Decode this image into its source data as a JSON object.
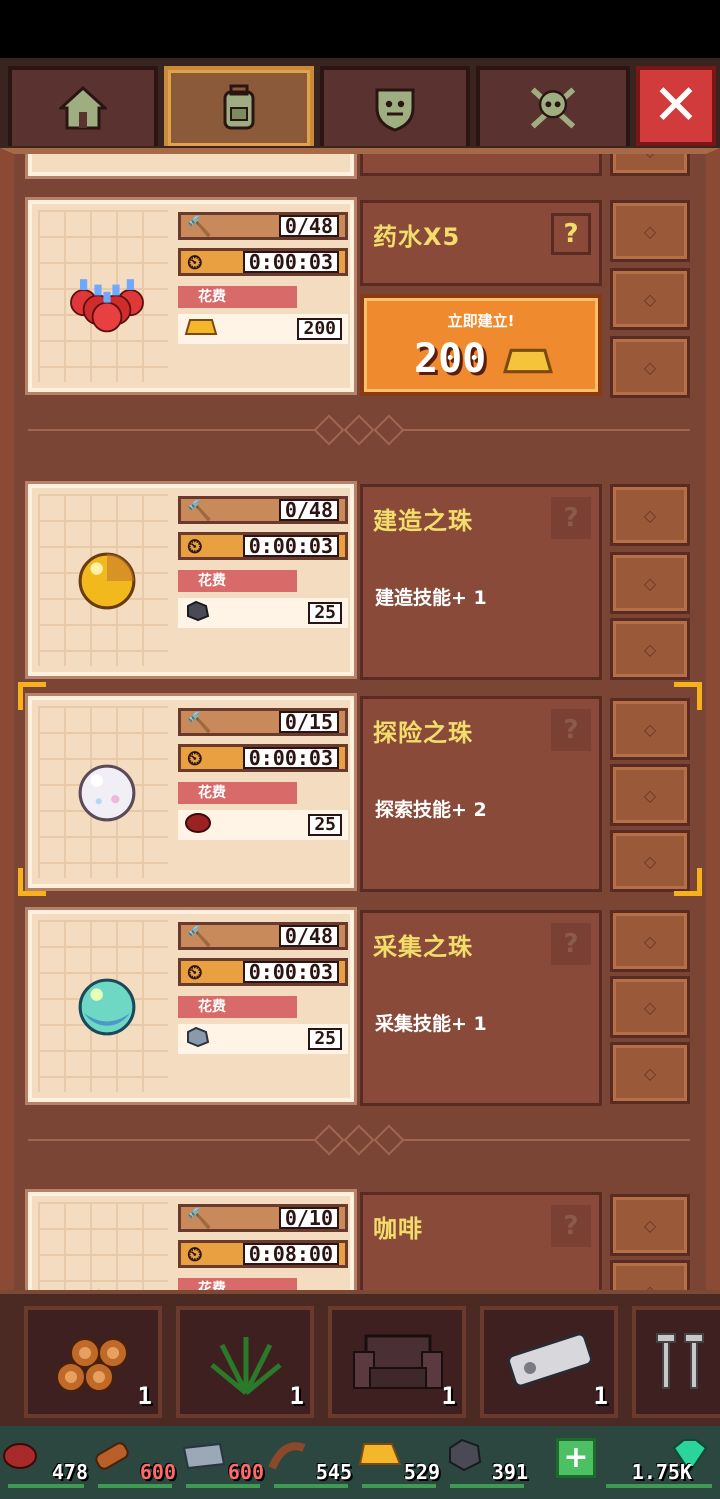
{
  "tabs": [
    {
      "icon": "house-icon"
    },
    {
      "icon": "backpack-icon"
    },
    {
      "icon": "shield-demon-icon"
    },
    {
      "icon": "skull-crossbones-icon"
    }
  ],
  "close_label": "✕",
  "recipes": [
    {
      "name": "药水X5",
      "art": "potions-icon",
      "built": "0/48",
      "time": "0:00:03",
      "cost_label": "花费",
      "cost_icon": "gold-ingot-icon",
      "cost_value": "200",
      "help": "?",
      "build_now_label": "立即建立!",
      "build_now_price": "200"
    },
    {
      "name": "建造之珠",
      "art": "gold-orb-icon",
      "built": "0/48",
      "time": "0:00:03",
      "cost_label": "花费",
      "cost_icon": "coal-icon",
      "cost_value": "25",
      "desc": "建造技能+ 1",
      "help": "?"
    },
    {
      "name": "探险之珠",
      "art": "pearl-orb-icon",
      "built": "0/15",
      "time": "0:00:03",
      "cost_label": "花费",
      "cost_icon": "meat-icon",
      "cost_value": "25",
      "desc": "探索技能+ 2",
      "help": "?"
    },
    {
      "name": "采集之珠",
      "art": "aqua-orb-icon",
      "built": "0/48",
      "time": "0:00:03",
      "cost_label": "花费",
      "cost_icon": "iron-icon",
      "cost_value": "25",
      "desc": "采集技能+ 1",
      "help": "?"
    },
    {
      "name": "咖啡",
      "art": "coffee-icon",
      "built": "0/10",
      "time": "0:08:00",
      "cost_label": "花费",
      "help": "?"
    }
  ],
  "inventory": [
    {
      "icon": "logs-icon",
      "count": "1"
    },
    {
      "icon": "grass-icon",
      "count": "1"
    },
    {
      "icon": "armchair-icon",
      "count": "1"
    },
    {
      "icon": "remote-icon",
      "count": "1"
    },
    {
      "icon": "nails-icon",
      "count": ""
    }
  ],
  "resources": [
    {
      "icon": "meat-icon",
      "value": "478",
      "color": "#ffffff"
    },
    {
      "icon": "wood-icon",
      "value": "600",
      "color": "#ff6a6a"
    },
    {
      "icon": "iron-icon",
      "value": "600",
      "color": "#ff6a6a"
    },
    {
      "icon": "rope-icon",
      "value": "545",
      "color": "#ffffff"
    },
    {
      "icon": "gold-icon",
      "value": "529",
      "color": "#ffffff"
    },
    {
      "icon": "coal-icon",
      "value": "391",
      "color": "#ffffff"
    },
    {
      "icon": "gem-icon",
      "value": "1.75K",
      "color": "#ffffff"
    }
  ],
  "plus_label": "+"
}
